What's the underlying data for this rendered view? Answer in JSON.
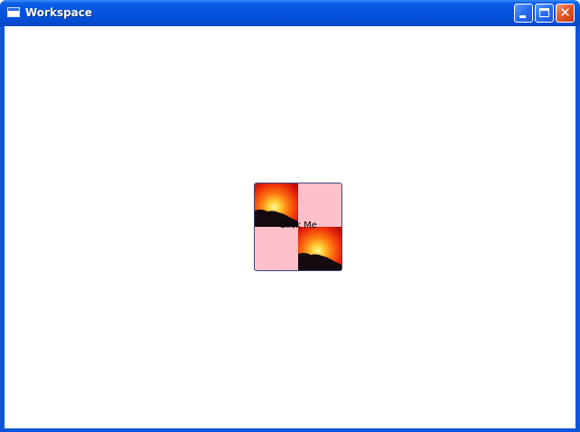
{
  "window": {
    "title": "Workspace",
    "title_icon": "app-window-icon",
    "controls": {
      "minimize_icon": "minimize-icon",
      "maximize_icon": "maximize-icon",
      "close_icon": "close-icon",
      "close_glyph": "✕"
    }
  },
  "main": {
    "button": {
      "label": "Click Me",
      "tile_pattern": [
        "sunset-image",
        "pink",
        "pink",
        "sunset-image"
      ],
      "tile_color": "#ffc0cb"
    }
  },
  "colors": {
    "titlebar": "#0553de",
    "frame": "#0a56dc",
    "client": "#ffffff",
    "close": "#e25a2c"
  }
}
